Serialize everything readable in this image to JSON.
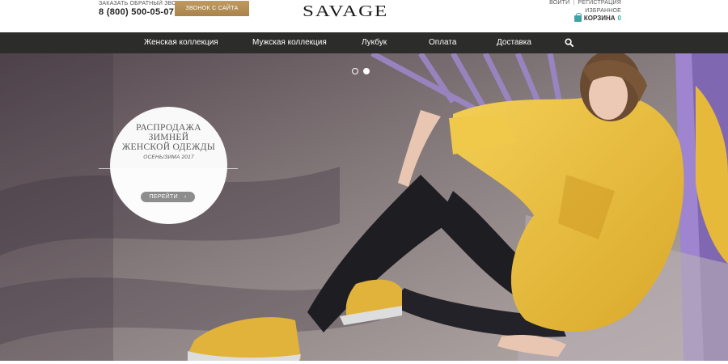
{
  "header": {
    "callback_caption": "ЗАКАЗАТЬ ОБРАТНЫЙ ЗВОНОК",
    "phone": "8 (800) 500-05-07",
    "call_button": "ЗВОНОК С САЙТА",
    "logo": "SAVAGE",
    "login": "ВОЙТИ",
    "separator": "|",
    "register": "РЕГИСТРАЦИЯ",
    "favorites": "ИЗБРАННОЕ",
    "cart_label": "КОРЗИНА",
    "cart_count": "0"
  },
  "nav": {
    "items": [
      {
        "label": "Женская коллекция"
      },
      {
        "label": "Мужская коллекция"
      },
      {
        "label": "Лукбук"
      },
      {
        "label": "Оплата"
      },
      {
        "label": "Доставка"
      }
    ],
    "search_icon": "search-icon"
  },
  "hero": {
    "slides_total": 2,
    "active_slide": 2,
    "promo_title_lines": [
      "РАСПРОДАЖА",
      "ЗИМНЕЙ",
      "ЖЕНСКОЙ ОДЕЖДЫ"
    ],
    "promo_season": "ОСЕНЬ/ЗИМА 2017",
    "button_label": "ПЕРЕЙТИ",
    "button_icon": "chevron-right-icon"
  },
  "colors": {
    "accent_gold": "#b79055",
    "nav_background": "#2c2c2b",
    "cart_teal": "#3fa3a3"
  }
}
